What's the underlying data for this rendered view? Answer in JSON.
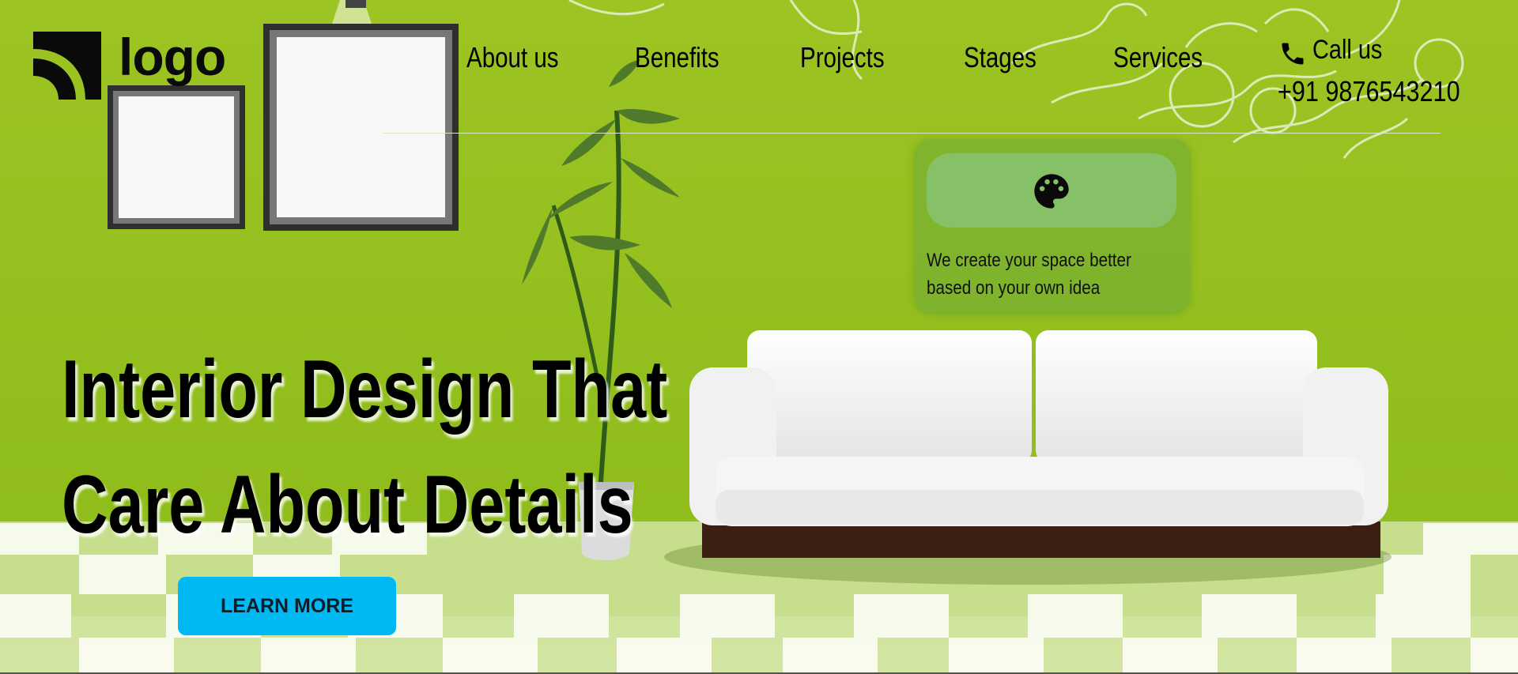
{
  "brand": {
    "logo_text": "logo"
  },
  "nav": {
    "items": [
      {
        "label": "About us"
      },
      {
        "label": "Benefits"
      },
      {
        "label": "Projects"
      },
      {
        "label": "Stages"
      },
      {
        "label": "Services"
      }
    ]
  },
  "contact": {
    "call_label": "Call us",
    "phone": "+91 9876543210"
  },
  "feature_card": {
    "icon": "palette-icon",
    "text": "We create your space better based on your own idea"
  },
  "hero": {
    "headline_line1": "Interior Design That",
    "headline_line2": "Care About Details",
    "cta_label": "LEARN MORE"
  },
  "colors": {
    "background": "#8fbc1f",
    "cta": "#00b9f2",
    "card_pill": "#86c067"
  }
}
